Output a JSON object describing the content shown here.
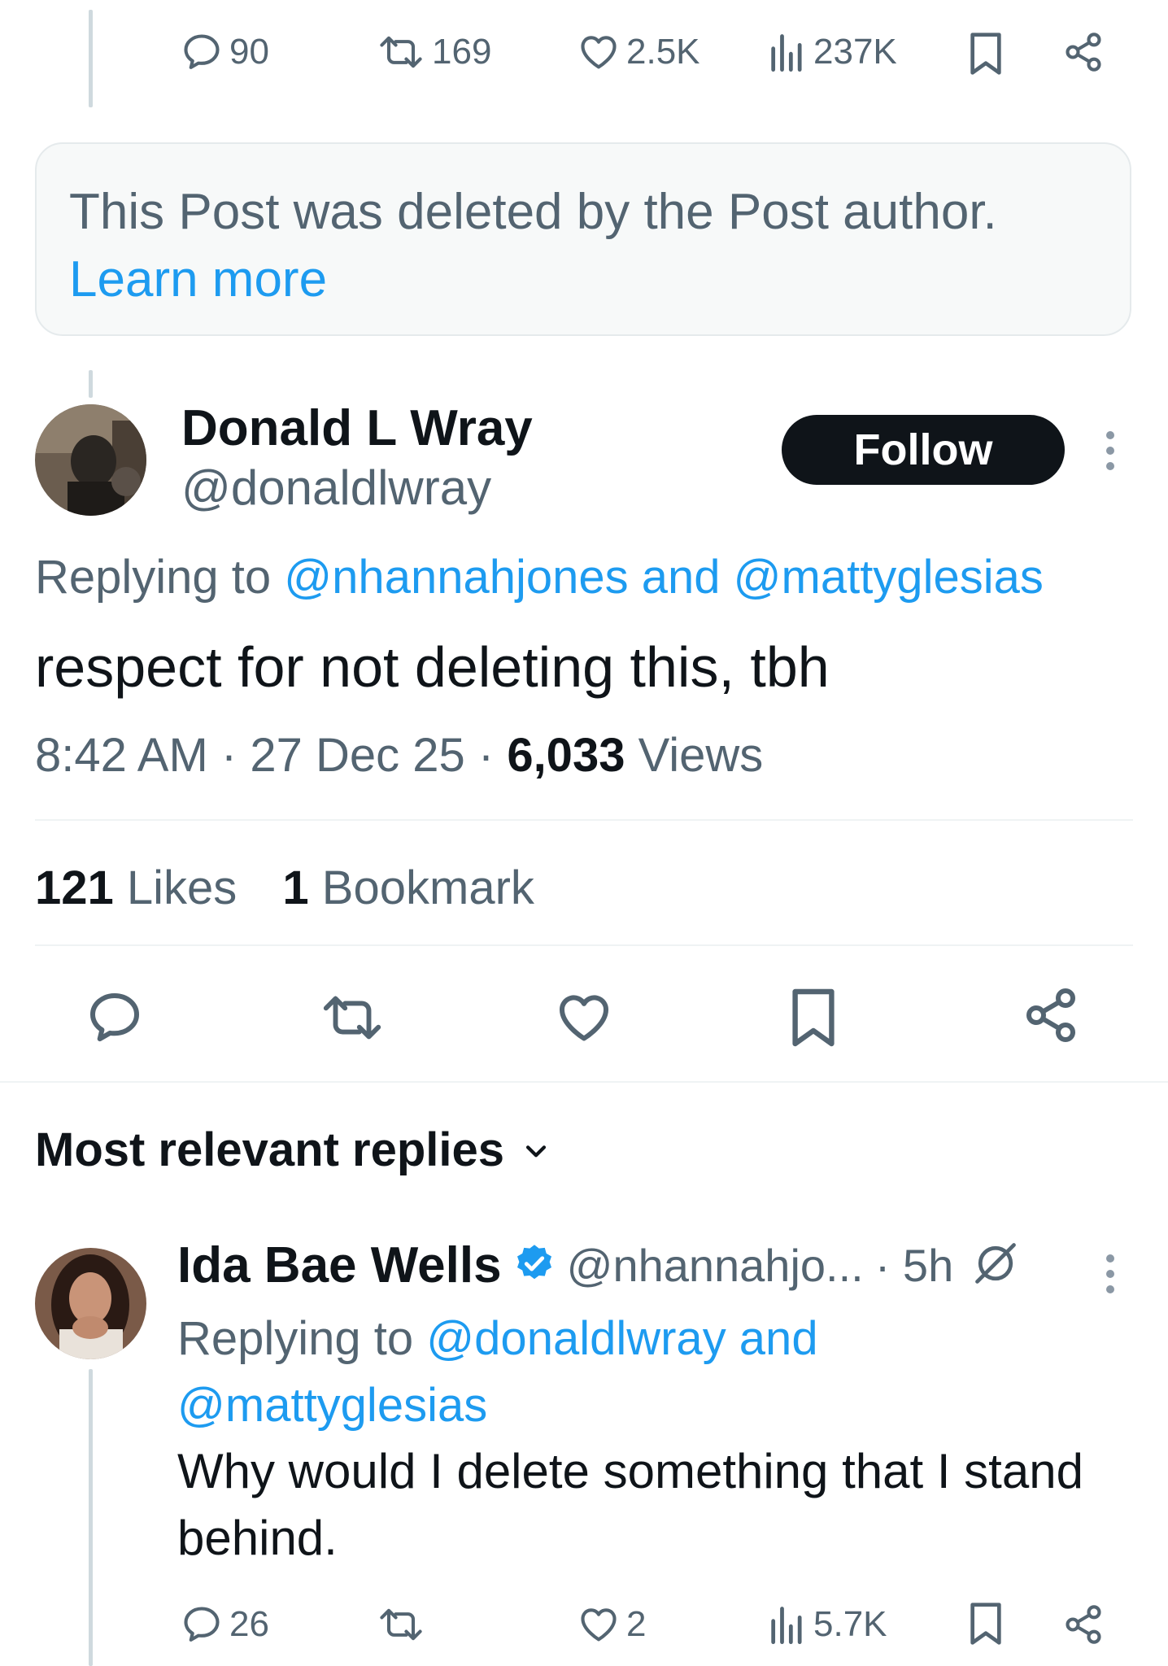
{
  "top_actions": {
    "replies": "90",
    "reposts": "169",
    "likes": "2.5K",
    "views": "237K"
  },
  "deleted_notice": {
    "message": "This Post was deleted by the Post author.",
    "learn_more": "Learn more"
  },
  "post": {
    "author_name": "Donald L Wray",
    "author_handle": "@donaldlwray",
    "follow_label": "Follow",
    "replying_prefix": "Replying to ",
    "replying_to": "@nhannahjones and @mattyglesias",
    "text": "respect for not deleting this, tbh",
    "time": "8:42 AM",
    "sep": " · ",
    "date": "27 Dec 25",
    "views_count": "6,033",
    "views_label": " Views",
    "likes_count": "121",
    "likes_label": " Likes",
    "bookmarks_count": "1",
    "bookmarks_label": " Bookmark"
  },
  "replies_section": {
    "title": "Most relevant replies"
  },
  "reply": {
    "author_name": "Ida Bae Wells",
    "author_handle": "@nhannahjo...",
    "age": "· 5h",
    "replying_prefix": "Replying to ",
    "replying_to_line1": "@donaldlwray and",
    "replying_to_line2": "@mattyglesias",
    "text_line1": "Why would I delete something that I stand",
    "text_line2": "behind.",
    "actions": {
      "replies": "26",
      "likes": "2",
      "views": "5.7K"
    }
  },
  "colors": {
    "accent": "#1d9bf0",
    "text": "#0f1419",
    "muted": "#536471",
    "verified": "#1d9bf0"
  }
}
